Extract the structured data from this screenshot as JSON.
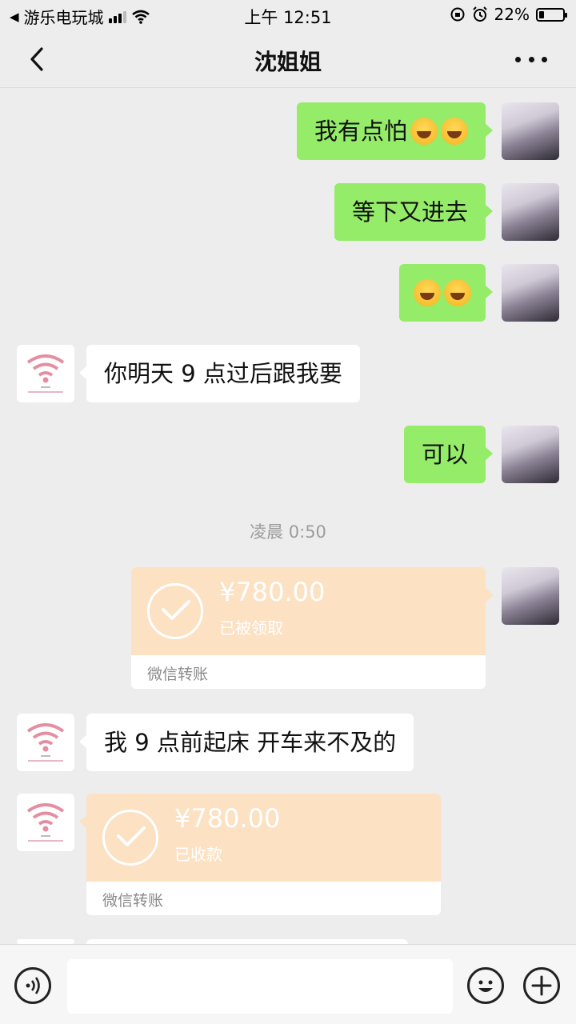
{
  "status_bar": {
    "carrier": "游乐电玩城",
    "time": "上午 12:51",
    "battery": "22%",
    "battery_level": 0.22
  },
  "nav": {
    "title": "沈姐姐",
    "back_icon": "chevron-left-icon",
    "more_icon": "more-dots-icon"
  },
  "messages": [
    {
      "side": "me",
      "text": "我有点怕",
      "emoji_count": 2
    },
    {
      "side": "me",
      "text": "等下又进去"
    },
    {
      "side": "me",
      "text": "",
      "emoji_count": 2
    },
    {
      "side": "them",
      "text": "你明天 9 点过后跟我要"
    },
    {
      "side": "me",
      "text": "可以"
    }
  ],
  "timestamp": "凌晨 0:50",
  "transfers": [
    {
      "side": "me",
      "amount": "¥780.00",
      "status": "已被领取",
      "label": "微信转账"
    },
    {
      "side": "them",
      "amount": "¥780.00",
      "status": "已收款",
      "label": "微信转账"
    }
  ],
  "later_message": {
    "side": "them",
    "text": "我 9 点前起床 开车来不及的"
  },
  "input_bar": {
    "voice_icon": "voice-icon",
    "emoji_icon": "emoji-icon",
    "plus_icon": "plus-icon"
  },
  "colors": {
    "background": "#ededed",
    "my_bubble": "#95ec69",
    "their_bubble": "#ffffff",
    "transfer": "#fce1c3"
  }
}
